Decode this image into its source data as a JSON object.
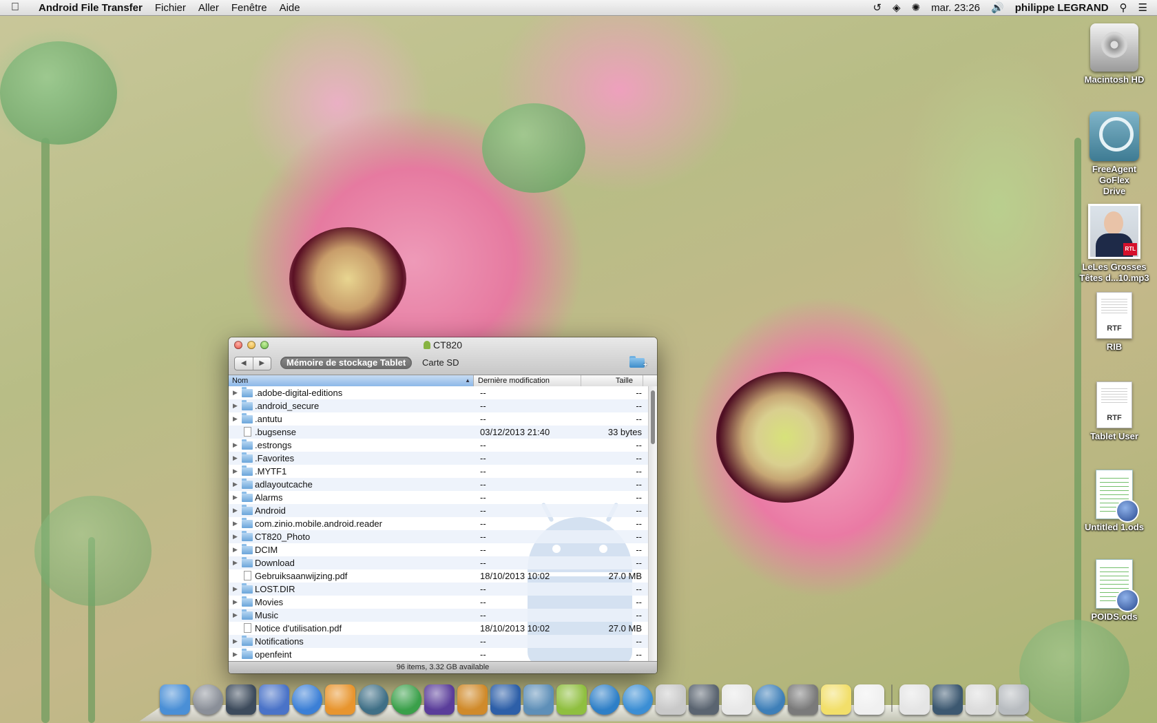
{
  "menubar": {
    "app_name": "Android File Transfer",
    "menus": [
      "Fichier",
      "Aller",
      "Fenêtre",
      "Aide"
    ],
    "clock": "mar. 23:26",
    "user": "philippe LEGRAND",
    "icons": [
      "time-machine-icon",
      "wifi-icon",
      "bluetooth-icon",
      "volume-icon",
      "spotlight-icon",
      "notification-center-icon"
    ]
  },
  "desktop": {
    "icons": [
      {
        "label": "Macintosh HD",
        "icon": "hard-drive-icon"
      },
      {
        "label": "FreeAgent GoFlex Drive",
        "icon": "time-machine-drive-icon"
      },
      {
        "label": "LeLes Grosses Têtes d...10.mp3",
        "icon": "audio-file-icon"
      },
      {
        "label": "RIB",
        "icon": "rtf-document-icon",
        "type_label": "RTF"
      },
      {
        "label": "Tablet User",
        "icon": "rtf-document-icon",
        "type_label": "RTF"
      },
      {
        "label": "Untitled 1.ods",
        "icon": "spreadsheet-icon"
      },
      {
        "label": "POIDS.ods",
        "icon": "spreadsheet-icon"
      }
    ]
  },
  "window": {
    "title": "CT820",
    "tabs": [
      {
        "label": "Mémoire de stockage Tablet",
        "active": true
      },
      {
        "label": "Carte SD",
        "active": false
      }
    ],
    "columns": {
      "name": "Nom",
      "modified": "Dernière modification",
      "size": "Taille"
    },
    "rows": [
      {
        "name": ".adobe-digital-editions",
        "type": "folder",
        "modified": "--",
        "size": "--"
      },
      {
        "name": ".android_secure",
        "type": "folder",
        "modified": "--",
        "size": "--"
      },
      {
        "name": ".antutu",
        "type": "folder",
        "modified": "--",
        "size": "--"
      },
      {
        "name": ".bugsense",
        "type": "file",
        "modified": "03/12/2013 21:40",
        "size": "33 bytes"
      },
      {
        "name": ".estrongs",
        "type": "folder",
        "modified": "--",
        "size": "--"
      },
      {
        "name": ".Favorites",
        "type": "folder",
        "modified": "--",
        "size": "--"
      },
      {
        "name": ".MYTF1",
        "type": "folder",
        "modified": "--",
        "size": "--"
      },
      {
        "name": "adlayoutcache",
        "type": "folder",
        "modified": "--",
        "size": "--"
      },
      {
        "name": "Alarms",
        "type": "folder",
        "modified": "--",
        "size": "--"
      },
      {
        "name": "Android",
        "type": "folder",
        "modified": "--",
        "size": "--"
      },
      {
        "name": "com.zinio.mobile.android.reader",
        "type": "folder",
        "modified": "--",
        "size": "--"
      },
      {
        "name": "CT820_Photo",
        "type": "folder",
        "modified": "--",
        "size": "--"
      },
      {
        "name": "DCIM",
        "type": "folder",
        "modified": "--",
        "size": "--"
      },
      {
        "name": "Download",
        "type": "folder",
        "modified": "--",
        "size": "--"
      },
      {
        "name": "Gebruiksaanwijzing.pdf",
        "type": "file",
        "modified": "18/10/2013 10:02",
        "size": "27.0 MB"
      },
      {
        "name": "LOST.DIR",
        "type": "folder",
        "modified": "--",
        "size": "--"
      },
      {
        "name": "Movies",
        "type": "folder",
        "modified": "--",
        "size": "--"
      },
      {
        "name": "Music",
        "type": "folder",
        "modified": "--",
        "size": "--"
      },
      {
        "name": "Notice d'utilisation.pdf",
        "type": "file",
        "modified": "18/10/2013 10:02",
        "size": "27.0 MB"
      },
      {
        "name": "Notifications",
        "type": "folder",
        "modified": "--",
        "size": "--"
      },
      {
        "name": "openfeint",
        "type": "folder",
        "modified": "--",
        "size": "--"
      }
    ],
    "status": "96 items, 3.32 GB available"
  },
  "dock": {
    "apps": [
      {
        "name": "finder-icon",
        "color": "#4a8fd6"
      },
      {
        "name": "launchpad-icon",
        "color": "#8a8f98"
      },
      {
        "name": "mission-control-icon",
        "color": "#3d4b5c"
      },
      {
        "name": "pages-icon",
        "color": "#4a73c8"
      },
      {
        "name": "itunes-icon",
        "color": "#3b7fd6"
      },
      {
        "name": "ibooks-icon",
        "color": "#e8952e"
      },
      {
        "name": "time-machine-icon",
        "color": "#3f6f86"
      },
      {
        "name": "checkmark-app-icon",
        "color": "#3aa04a"
      },
      {
        "name": "imovie-icon",
        "color": "#5a3d9a"
      },
      {
        "name": "game-app-icon",
        "color": "#d08a2a"
      },
      {
        "name": "thunderbird-icon",
        "color": "#2d5fa8"
      },
      {
        "name": "iphoto-icon",
        "color": "#5e8fb8"
      },
      {
        "name": "android-file-transfer-icon",
        "color": "#8fbf3f"
      },
      {
        "name": "globe-app-icon",
        "color": "#2e7fc7"
      },
      {
        "name": "safari-icon",
        "color": "#3b8ed4"
      },
      {
        "name": "script-app-icon",
        "color": "#c9c9c9"
      },
      {
        "name": "facetime-icon",
        "color": "#5a6470"
      },
      {
        "name": "reminders-icon",
        "color": "#e8e8e8"
      },
      {
        "name": "airport-utility-icon",
        "color": "#3e7fb8"
      },
      {
        "name": "printer-icon",
        "color": "#7a7a7a"
      },
      {
        "name": "stickies-icon",
        "color": "#f2df6a"
      },
      {
        "name": "textedit-icon",
        "color": "#f0f0f0"
      },
      {
        "name": "document-stack-icon",
        "color": "#e5e5e5"
      },
      {
        "name": "screen-icon",
        "color": "#3c5870"
      },
      {
        "name": "downloads-icon",
        "color": "#dcdcdc"
      },
      {
        "name": "trash-icon",
        "color": "#b8bcc0"
      }
    ]
  }
}
